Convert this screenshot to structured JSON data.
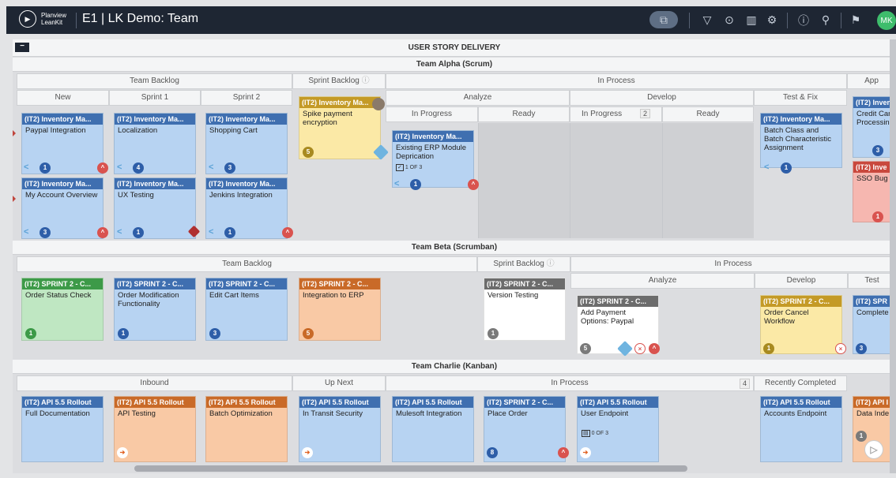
{
  "topbar": {
    "logo_line1": "Planview",
    "logo_line2": "LeanKit",
    "title": "E1 | LK Demo: Team",
    "avatar": "MK",
    "icons": [
      "board-view-icon",
      "filter-icon",
      "legend-icon",
      "analytics-icon",
      "settings-icon",
      "info-icon",
      "search-icon",
      "notifications-icon"
    ]
  },
  "board": {
    "main_lane": "USER STORY DELIVERY",
    "alpha": {
      "title": "Team Alpha (Scrum)",
      "h_backlog": "Team Backlog",
      "h_sprint_backlog": "Sprint Backlog",
      "h_in_process": "In Process",
      "h_app": "App",
      "h_new": "New",
      "h_sprint1": "Sprint 1",
      "h_sprint2": "Sprint 2",
      "h_analyze": "Analyze",
      "h_develop": "Develop",
      "h_test_fix": "Test & Fix",
      "h_in_progress": "In Progress",
      "h_ready": "Ready",
      "h_dev_in_progress": "In Progress",
      "h_dev_count": "2",
      "h_dev_ready": "Ready"
    },
    "beta": {
      "title": "Team Beta (Scrumban)",
      "h_backlog": "Team Backlog",
      "h_sprint_backlog": "Sprint Backlog",
      "h_in_process": "In Process",
      "h_analyze": "Analyze",
      "h_develop": "Develop",
      "h_test": "Test"
    },
    "charlie": {
      "title": "Team Charlie (Kanban)",
      "h_inbound": "Inbound",
      "h_up_next": "Up Next",
      "h_in_process": "In Process",
      "h_in_process_count": "4",
      "h_recently_completed": "Recently Completed"
    }
  },
  "cards": {
    "a1": {
      "type": "(IT2) Inventory Ma...",
      "title": "Paypal Integration",
      "badge": "1"
    },
    "a2": {
      "type": "(IT2) Inventory Ma...",
      "title": "My Account Overview",
      "badge": "3"
    },
    "a3": {
      "type": "(IT2) Inventory Ma...",
      "title": "Localization",
      "badge": "4"
    },
    "a4": {
      "type": "(IT2) Inventory Ma...",
      "title": "UX Testing",
      "badge": "1"
    },
    "a5": {
      "type": "(IT2) Inventory Ma...",
      "title": "Shopping Cart",
      "badge": "3"
    },
    "a6": {
      "type": "(IT2) Inventory Ma...",
      "title": "Jenkins Integration",
      "badge": "1"
    },
    "a7": {
      "type": "(IT2) Inventory Ma...",
      "title": "Spike payment encryption",
      "badge": "5"
    },
    "a8": {
      "type": "(IT2) Inventory Ma...",
      "title": "Existing ERP Module Deprication",
      "badge": "1",
      "task": "1 OF 3"
    },
    "a9": {
      "type": "(IT2) Inventory Ma...",
      "title": "Batch Class and Batch Characteristic Assignment",
      "badge": "1"
    },
    "a10": {
      "type": "(IT2) Invent",
      "title": "Credit Car Processin",
      "badge": "3"
    },
    "a11": {
      "type": "(IT2) Inve",
      "title": "SSO Bug",
      "badge": "1"
    },
    "b1": {
      "type": "(IT2) SPRINT 2 - C...",
      "title": "Order Status Check",
      "badge": "1"
    },
    "b2": {
      "type": "(IT2) SPRINT 2 - C...",
      "title": "Order Modification Functionality",
      "badge": "1"
    },
    "b3": {
      "type": "(IT2) SPRINT 2 - C...",
      "title": "Edit Cart Items",
      "badge": "3"
    },
    "b4": {
      "type": "(IT2) SPRINT 2 - C...",
      "title": "Integration to ERP",
      "badge": "5"
    },
    "b5": {
      "type": "(IT2) SPRINT 2 - C...",
      "title": "Version Testing",
      "badge": "1"
    },
    "b6": {
      "type": "(IT2) SPRINT 2 - C...",
      "title": "Add Payment Options: Paypal",
      "badge": "5"
    },
    "b7": {
      "type": "(IT2) SPRINT 2 - C...",
      "title": "Order Cancel Workflow",
      "badge": "1"
    },
    "b8": {
      "type": "(IT2) SPR",
      "title": "Complete",
      "badge": "3"
    },
    "c1": {
      "type": "(IT2) API 5.5 Rollout",
      "title": "Full Documentation"
    },
    "c2": {
      "type": "(IT2) API 5.5 Rollout",
      "title": "API Testing"
    },
    "c3": {
      "type": "(IT2) API 5.5 Rollout",
      "title": "Batch Optimization"
    },
    "c4": {
      "type": "(IT2) API 5.5 Rollout",
      "title": "In Transit Security"
    },
    "c5": {
      "type": "(IT2) API 5.5 Rollout",
      "title": "Mulesoft Integration"
    },
    "c6": {
      "type": "(IT2) SPRINT 2 - C...",
      "title": "Place Order",
      "badge": "8"
    },
    "c7": {
      "type": "(IT2) API 5.5 Rollout",
      "title": "User Endpoint",
      "task": "0 OF 3"
    },
    "c8": {
      "type": "(IT2) API 5.5 Rollout",
      "title": "Accounts Endpoint"
    },
    "c9": {
      "type": "(IT2) API I",
      "title": "Data Inde:",
      "badge": "1"
    }
  }
}
